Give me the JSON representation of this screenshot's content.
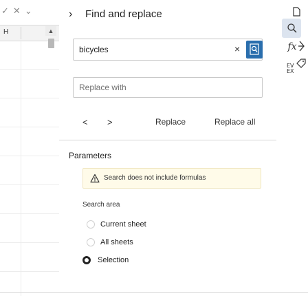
{
  "sheet": {
    "column_label": "H"
  },
  "panel": {
    "title": "Find and replace",
    "find_value": "bicycles",
    "replace_placeholder": "Replace with",
    "actions": {
      "prev": "<",
      "next": ">",
      "replace": "Replace",
      "replace_all": "Replace all"
    },
    "parameters_title": "Parameters",
    "notice_text": "Search does not include formulas",
    "search_area_title": "Search area",
    "options": [
      {
        "label": "Current sheet",
        "checked": false
      },
      {
        "label": "All sheets",
        "checked": false
      },
      {
        "label": "Selection",
        "checked": true
      }
    ]
  },
  "rail": {
    "sort_label_top": "EV",
    "sort_label_bottom": "EX"
  },
  "colors": {
    "accent": "#2a6ead",
    "active_tool": "#dce4ef",
    "notice_bg": "#fffbe9",
    "warning": "#333333"
  }
}
